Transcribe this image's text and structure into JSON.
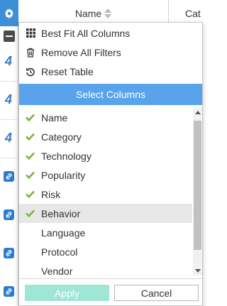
{
  "table": {
    "columns": [
      "Name",
      "Cat"
    ]
  },
  "menu": {
    "actions": [
      {
        "label": "Best Fit All Columns",
        "icon": "grid-icon"
      },
      {
        "label": "Remove All Filters",
        "icon": "trash-icon"
      },
      {
        "label": "Reset Table",
        "icon": "reset-icon"
      }
    ],
    "section_title": "Select Columns",
    "columns": [
      {
        "label": "Name",
        "checked": true
      },
      {
        "label": "Category",
        "checked": true
      },
      {
        "label": "Technology",
        "checked": true
      },
      {
        "label": "Popularity",
        "checked": true
      },
      {
        "label": "Risk",
        "checked": true
      },
      {
        "label": "Behavior",
        "checked": true
      },
      {
        "label": "Language",
        "checked": false
      },
      {
        "label": "Protocol",
        "checked": false
      },
      {
        "label": "Vendor",
        "checked": false
      }
    ],
    "apply_label": "Apply",
    "cancel_label": "Cancel"
  },
  "colors": {
    "accent": "#59a3ec",
    "check": "#7cb342",
    "apply_disabled": "#9fe6d6"
  }
}
